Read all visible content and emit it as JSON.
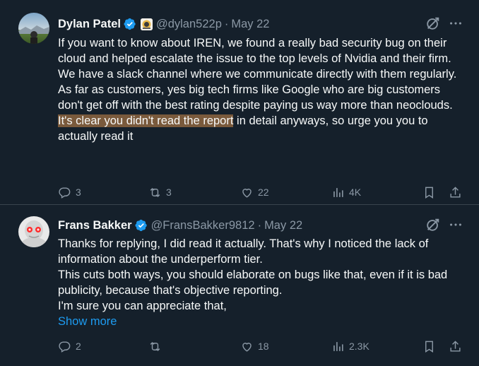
{
  "tweets": [
    {
      "author": "Dylan Patel",
      "handle": "@dylan522p",
      "date": "May 22",
      "paragraphs": [
        "If you want to know about IREN, we found a really bad security bug on their cloud and helped escalate the issue to the top levels of Nvidia and their firm. We have a slack channel where we communicate directly with them regularly.",
        "As far as customers, yes big tech firms like Google who are big customers don't get off with the best rating despite paying us way more than neoclouds."
      ],
      "highlight": "It's clear you didn't read the report",
      "highlight_rest": " in detail anyways, so urge you you to actually read it",
      "replies": "3",
      "retweets": "3",
      "likes": "22",
      "views": "4K"
    },
    {
      "author": "Frans Bakker",
      "handle": "@FransBakker9812",
      "date": "May 22",
      "paragraphs": [
        "Thanks for replying, I did read it actually. That's why I noticed the lack of information about the underperform tier.",
        "This cuts both ways, you should elaborate on bugs like that, even if it is bad publicity, because that's objective reporting.",
        "I'm sure you can appreciate that,"
      ],
      "show_more": "Show more",
      "replies": "2",
      "retweets": "",
      "likes": "18",
      "views": "2.3K"
    }
  ],
  "separator": "·",
  "colors": {
    "background": "#15202b",
    "text": "#f7f9f9",
    "muted": "#8b98a5",
    "link": "#1d9bf0",
    "verified": "#1d9bf0",
    "highlight": "#7a5a3c"
  },
  "icons": [
    "verified-badge-icon",
    "affiliate-badge-icon",
    "grok-icon",
    "more-icon",
    "reply-icon",
    "retweet-icon",
    "like-icon",
    "views-icon",
    "bookmark-icon",
    "share-icon"
  ]
}
